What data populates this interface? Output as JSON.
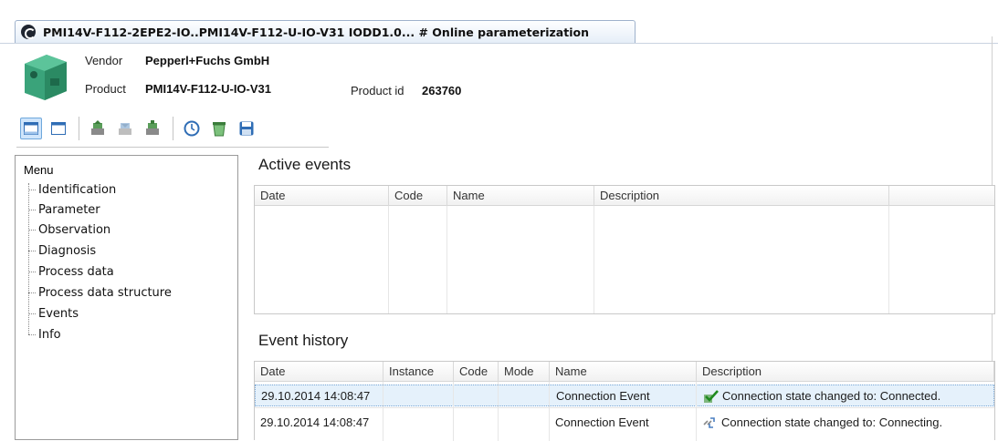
{
  "tab": {
    "title": "PMI14V-F112-2EPE2-IO..PMI14V-F112-U-IO-V31 IODD1.0... # Online parameterization"
  },
  "device": {
    "vendor_label": "Vendor",
    "vendor": "Pepperl+Fuchs GmbH",
    "product_label": "Product",
    "product": "PMI14V-F112-U-IO-V31",
    "product_id_label": "Product id",
    "product_id": "263760"
  },
  "toolbar": {
    "buttons": [
      {
        "icon": "window-layout-icon",
        "pressed": true
      },
      {
        "icon": "window-layout-alt-icon",
        "pressed": false
      },
      {
        "icon": "upload-device-icon",
        "pressed": false
      },
      {
        "icon": "download-device-icon",
        "pressed": false
      },
      {
        "icon": "sync-device-icon",
        "pressed": false
      },
      {
        "icon": "clock-icon",
        "pressed": false
      },
      {
        "icon": "recycle-icon",
        "pressed": false
      },
      {
        "icon": "save-icon",
        "pressed": false
      }
    ]
  },
  "menu": {
    "title": "Menu",
    "items": [
      "Identification",
      "Parameter",
      "Observation",
      "Diagnosis",
      "Process data",
      "Process data structure",
      "Events",
      "Info"
    ]
  },
  "active_events": {
    "title": "Active events",
    "columns": [
      "Date",
      "Code",
      "Name",
      "Description"
    ]
  },
  "event_history": {
    "title": "Event history",
    "columns": [
      "Date",
      "Instance",
      "Code",
      "Mode",
      "Name",
      "Description"
    ],
    "rows": [
      {
        "date": "29.10.2014 14:08:47",
        "instance": "",
        "code": "",
        "mode": "",
        "name": "Connection Event",
        "description": "Connection state changed to: Connected.",
        "icon": "connected-icon"
      },
      {
        "date": "29.10.2014 14:08:47",
        "instance": "",
        "code": "",
        "mode": "",
        "name": "Connection Event",
        "description": "Connection state changed to: Connecting.",
        "icon": "connecting-icon"
      }
    ]
  },
  "colors": {
    "accent": "#6fa8dc",
    "selection": "#e5f1fb",
    "device_green": "#3aa37a"
  }
}
